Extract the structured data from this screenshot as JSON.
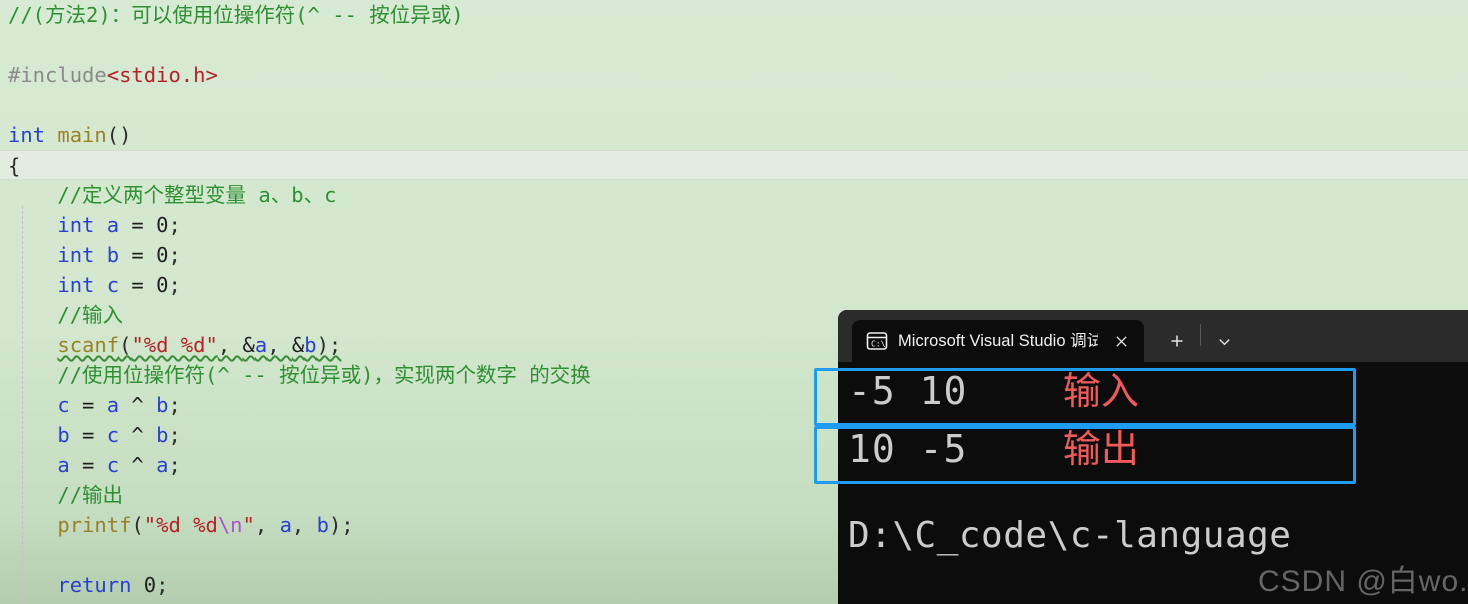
{
  "editor": {
    "background_color": "#d5e8d0",
    "lines": [
      {
        "id": "l1",
        "indent": 0,
        "tokens": [
          {
            "cls": "c-comment",
            "t": "//(方法2)：可以使用位操作符(^ -- 按位异或)"
          }
        ]
      },
      {
        "id": "l2",
        "indent": 0,
        "tokens": []
      },
      {
        "id": "l3",
        "indent": 0,
        "tokens": [
          {
            "cls": "c-pre",
            "t": "#include"
          },
          {
            "cls": "c-header",
            "t": "<stdio.h>"
          }
        ]
      },
      {
        "id": "l4",
        "indent": 0,
        "tokens": []
      },
      {
        "id": "l5",
        "indent": 0,
        "tokens": [
          {
            "cls": "c-kw",
            "t": "int"
          },
          {
            "cls": "c-plain",
            "t": " "
          },
          {
            "cls": "c-fn",
            "t": "main"
          },
          {
            "cls": "c-punct",
            "t": "()"
          }
        ]
      },
      {
        "id": "l6",
        "indent": 0,
        "current": true,
        "tokens": [
          {
            "cls": "c-punct",
            "t": "{"
          }
        ]
      },
      {
        "id": "l7",
        "indent": 1,
        "tokens": [
          {
            "cls": "c-comment",
            "t": "//定义两个整型变量 a、b、c"
          }
        ]
      },
      {
        "id": "l8",
        "indent": 1,
        "tokens": [
          {
            "cls": "c-kw",
            "t": "int"
          },
          {
            "cls": "c-plain",
            "t": " "
          },
          {
            "cls": "c-var",
            "t": "a"
          },
          {
            "cls": "c-plain",
            "t": " = "
          },
          {
            "cls": "c-num",
            "t": "0"
          },
          {
            "cls": "c-punct",
            "t": ";"
          }
        ]
      },
      {
        "id": "l9",
        "indent": 1,
        "tokens": [
          {
            "cls": "c-kw",
            "t": "int"
          },
          {
            "cls": "c-plain",
            "t": " "
          },
          {
            "cls": "c-var",
            "t": "b"
          },
          {
            "cls": "c-plain",
            "t": " = "
          },
          {
            "cls": "c-num",
            "t": "0"
          },
          {
            "cls": "c-punct",
            "t": ";"
          }
        ]
      },
      {
        "id": "l10",
        "indent": 1,
        "tokens": [
          {
            "cls": "c-kw",
            "t": "int"
          },
          {
            "cls": "c-plain",
            "t": " "
          },
          {
            "cls": "c-var",
            "t": "c"
          },
          {
            "cls": "c-plain",
            "t": " = "
          },
          {
            "cls": "c-num",
            "t": "0"
          },
          {
            "cls": "c-punct",
            "t": ";"
          }
        ]
      },
      {
        "id": "l11",
        "indent": 1,
        "tokens": [
          {
            "cls": "c-comment",
            "t": "//输入"
          }
        ]
      },
      {
        "id": "l12",
        "indent": 1,
        "squiggle": true,
        "tokens": [
          {
            "cls": "c-fn",
            "t": "scanf"
          },
          {
            "cls": "c-punct",
            "t": "("
          },
          {
            "cls": "c-str",
            "t": "\"%d %d\""
          },
          {
            "cls": "c-punct",
            "t": ", "
          },
          {
            "cls": "c-plain",
            "t": "&"
          },
          {
            "cls": "c-var",
            "t": "a"
          },
          {
            "cls": "c-punct",
            "t": ", "
          },
          {
            "cls": "c-plain",
            "t": "&"
          },
          {
            "cls": "c-var",
            "t": "b"
          },
          {
            "cls": "c-punct",
            "t": ");"
          }
        ]
      },
      {
        "id": "l13",
        "indent": 1,
        "tokens": [
          {
            "cls": "c-comment",
            "t": "//使用位操作符(^ -- 按位异或)，实现两个数字 的交换"
          }
        ]
      },
      {
        "id": "l14",
        "indent": 1,
        "tokens": [
          {
            "cls": "c-var",
            "t": "c"
          },
          {
            "cls": "c-plain",
            "t": " = "
          },
          {
            "cls": "c-var",
            "t": "a"
          },
          {
            "cls": "c-plain",
            "t": " ^ "
          },
          {
            "cls": "c-var",
            "t": "b"
          },
          {
            "cls": "c-punct",
            "t": ";"
          }
        ]
      },
      {
        "id": "l15",
        "indent": 1,
        "tokens": [
          {
            "cls": "c-var",
            "t": "b"
          },
          {
            "cls": "c-plain",
            "t": " = "
          },
          {
            "cls": "c-var",
            "t": "c"
          },
          {
            "cls": "c-plain",
            "t": " ^ "
          },
          {
            "cls": "c-var",
            "t": "b"
          },
          {
            "cls": "c-punct",
            "t": ";"
          }
        ]
      },
      {
        "id": "l16",
        "indent": 1,
        "tokens": [
          {
            "cls": "c-var",
            "t": "a"
          },
          {
            "cls": "c-plain",
            "t": " = "
          },
          {
            "cls": "c-var",
            "t": "c"
          },
          {
            "cls": "c-plain",
            "t": " ^ "
          },
          {
            "cls": "c-var",
            "t": "a"
          },
          {
            "cls": "c-punct",
            "t": ";"
          }
        ]
      },
      {
        "id": "l17",
        "indent": 1,
        "tokens": [
          {
            "cls": "c-comment",
            "t": "//输出"
          }
        ]
      },
      {
        "id": "l18",
        "indent": 1,
        "tokens": [
          {
            "cls": "c-fn",
            "t": "printf"
          },
          {
            "cls": "c-punct",
            "t": "("
          },
          {
            "cls": "c-str",
            "t": "\"%d %d"
          },
          {
            "cls": "c-esc",
            "t": "\\n"
          },
          {
            "cls": "c-str",
            "t": "\""
          },
          {
            "cls": "c-punct",
            "t": ", "
          },
          {
            "cls": "c-var",
            "t": "a"
          },
          {
            "cls": "c-punct",
            "t": ", "
          },
          {
            "cls": "c-var",
            "t": "b"
          },
          {
            "cls": "c-punct",
            "t": ");"
          }
        ]
      },
      {
        "id": "l19",
        "indent": 0,
        "tokens": []
      },
      {
        "id": "l20",
        "indent": 1,
        "tokens": [
          {
            "cls": "c-kw",
            "t": "return"
          },
          {
            "cls": "c-plain",
            "t": " "
          },
          {
            "cls": "c-num",
            "t": "0"
          },
          {
            "cls": "c-punct",
            "t": ";"
          }
        ]
      }
    ]
  },
  "terminal": {
    "tab": {
      "title": "Microsoft Visual Studio 调试控",
      "icon": "console-icon",
      "close_label": "✕"
    },
    "new_tab_label": "+",
    "dropdown_label": "⌄",
    "output_rows": [
      {
        "id": "row-input",
        "text": "-5 10",
        "annotation": "输入"
      },
      {
        "id": "row-output",
        "text": "10 -5",
        "annotation": "输出"
      }
    ],
    "path_line": "D:\\C_code\\c-language",
    "annotation_color": "#f05a5a",
    "highlight_box_color": "#1e9cf0"
  },
  "watermark": {
    "text": "CSDN @白wo."
  }
}
